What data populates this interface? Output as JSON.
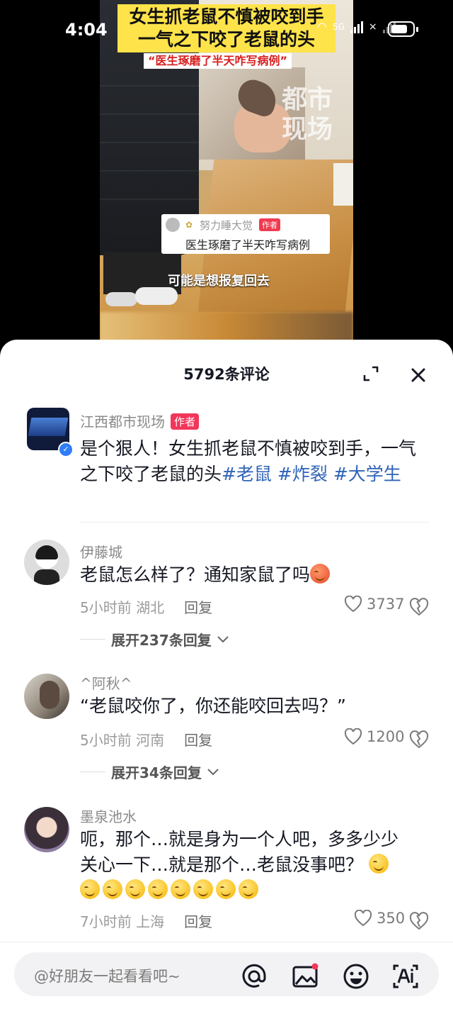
{
  "status_bar": {
    "time": "4:04",
    "network": "5G"
  },
  "video": {
    "headline_line1": "女生抓老鼠不慎被咬到手",
    "headline_line2": "一气之下咬了老鼠的头",
    "subheadline": "“医生琢磨了半天咋写病例”",
    "watermark_line1": "都市",
    "watermark_line2": "现场",
    "sticker": {
      "name": "努力睡大觉",
      "tag": "作者",
      "text": "医生琢磨了半天咋写病例"
    },
    "caption": "可能是想报复回去"
  },
  "comments_sheet": {
    "title": "5792条评论",
    "comments": [
      {
        "name": "江西都市现场",
        "author_tag": "作者",
        "text_prefix": "是个狠人！女生抓老鼠不慎被咬到手，一气之下咬了老鼠的头",
        "hashtags": [
          "#老鼠",
          "#炸裂",
          "#大学生"
        ]
      },
      {
        "name": "伊藤城",
        "text": "老鼠怎么样了？通知家鼠了吗",
        "time": "5小时前",
        "location": "湖北",
        "reply_label": "回复",
        "likes": "3737",
        "expand_label": "展开237条回复"
      },
      {
        "name": "^阿秋^",
        "text": "“老鼠咬你了，你还能咬回去吗？”",
        "time": "5小时前",
        "location": "河南",
        "reply_label": "回复",
        "likes": "1200",
        "expand_label": "展开34条回复"
      },
      {
        "name": "墨泉池水",
        "text_line1": "呃，那个…就是身为一个人吧，多多少少",
        "text_line2": "关心一下…就是那个…老鼠没事吧？",
        "time": "7小时前",
        "location": "上海",
        "reply_label": "回复",
        "likes": "350"
      }
    ]
  },
  "input_bar": {
    "placeholder": "@好朋友一起看看吧~"
  },
  "colors": {
    "hashtag": "#2f63b8",
    "author_tag": "#f2365a",
    "headline_bg": "#ffe34a"
  }
}
